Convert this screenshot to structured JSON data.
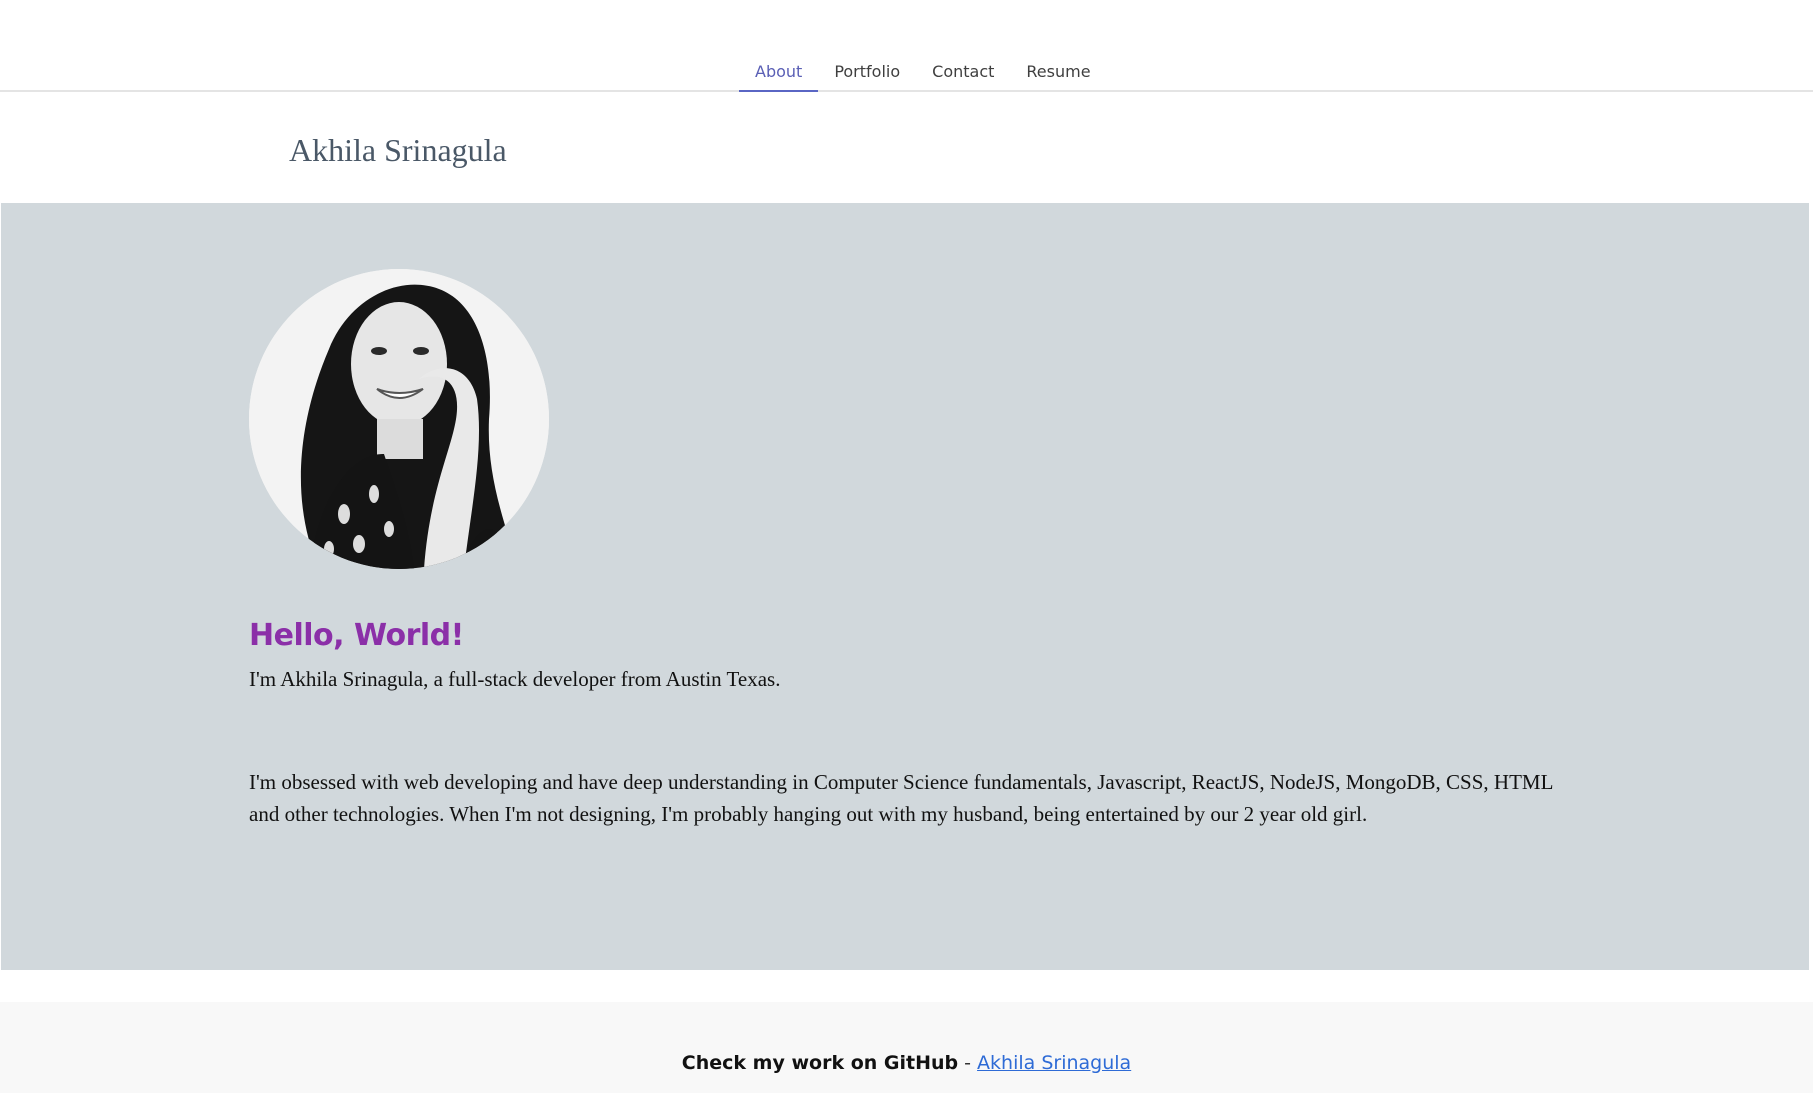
{
  "nav": {
    "tabs": [
      {
        "label": "About",
        "active": true
      },
      {
        "label": "Portfolio",
        "active": false
      },
      {
        "label": "Contact",
        "active": false
      },
      {
        "label": "Resume",
        "active": false
      }
    ]
  },
  "header": {
    "site_title": "Akhila Srinagula"
  },
  "about": {
    "avatar_alt": "profile-photo",
    "greeting": "Hello, World!",
    "intro": "I'm Akhila Srinagula, a full-stack developer from Austin Texas.",
    "bio": "I'm obsessed with web developing and have deep understanding in Computer Science fundamentals, Javascript, ReactJS, NodeJS, MongoDB, CSS, HTML and other technologies. When I'm not designing, I'm probably hanging out with my husband, being entertained by our 2 year old girl."
  },
  "footer": {
    "lead": "Check my work on GitHub",
    "separator": " - ",
    "link_text": "Akhila Srinagula"
  },
  "colors": {
    "accent_tab": "#5a66c4",
    "greeting": "#8b2fa8",
    "section_bg": "#d1d8dc",
    "link": "#2e6bd6"
  }
}
